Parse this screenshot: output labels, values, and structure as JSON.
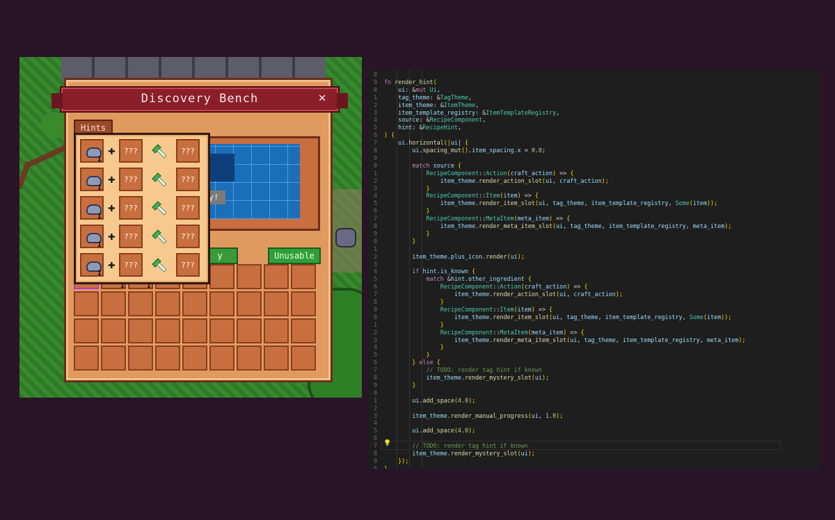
{
  "game": {
    "bench_title": "Discovery Bench",
    "close_glyph": "✕",
    "hints_tab_label": "Hints",
    "tooltip_fragment": "y!",
    "use_button_fragment": "y",
    "unusable_button_label": "Unusable",
    "hint_rows": [
      {
        "tier": "I",
        "slot2": "???",
        "slot3": "???"
      },
      {
        "tier": "I",
        "slot2": "???",
        "slot3": "???"
      },
      {
        "tier": "I",
        "slot2": "???",
        "slot3": "???"
      },
      {
        "tier": "I",
        "slot2": "???",
        "slot3": "???"
      },
      {
        "tier": "I",
        "slot2": "???",
        "slot3": "???"
      }
    ],
    "inventory_tiers": [
      "I",
      "I"
    ],
    "icons": {
      "ingredient": "stone-icon",
      "action": "green-hammer-icon",
      "plus": "plus-icon"
    }
  },
  "editor": {
    "lines": [
      {
        "n": "8",
        "t": ""
      },
      {
        "n": "9",
        "t": "fn render_hint("
      },
      {
        "n": "0",
        "t": "    ui: &mut Ui,"
      },
      {
        "n": "1",
        "t": "    tag_theme: &TagTheme,"
      },
      {
        "n": "2",
        "t": "    item_theme: &ItemTheme,"
      },
      {
        "n": "3",
        "t": "    item_template_registry: &ItemTemplateRegistry,"
      },
      {
        "n": "4",
        "t": "    source: &RecipeComponent,"
      },
      {
        "n": "5",
        "t": "    hint: &RecipeHint,"
      },
      {
        "n": "6",
        "t": ") {"
      },
      {
        "n": "7",
        "t": "    ui.horizontal(|ui| {"
      },
      {
        "n": "8",
        "t": "        ui.spacing_mut().item_spacing.x = 0.0;"
      },
      {
        "n": "9",
        "t": ""
      },
      {
        "n": "0",
        "t": "        match source {"
      },
      {
        "n": "1",
        "t": "            RecipeComponent::Action(craft_action) => {"
      },
      {
        "n": "2",
        "t": "                item_theme.render_action_slot(ui, craft_action);"
      },
      {
        "n": "3",
        "t": "            }"
      },
      {
        "n": "4",
        "t": "            RecipeComponent::Item(item) => {"
      },
      {
        "n": "5",
        "t": "                item_theme.render_item_slot(ui, tag_theme, item_template_registry, Some(item));"
      },
      {
        "n": "6",
        "t": "            }"
      },
      {
        "n": "7",
        "t": "            RecipeComponent::MetaItem(meta_item) => {"
      },
      {
        "n": "8",
        "t": "                item_theme.render_meta_item_slot(ui, tag_theme, item_template_registry, meta_item);"
      },
      {
        "n": "9",
        "t": "            }"
      },
      {
        "n": "0",
        "t": "        }"
      },
      {
        "n": "1",
        "t": ""
      },
      {
        "n": "2",
        "t": "        item_theme.plus_icon.render(ui);"
      },
      {
        "n": "3",
        "t": ""
      },
      {
        "n": "4",
        "t": "        if hint.is_known {"
      },
      {
        "n": "5",
        "t": "            match &hint.other_ingredient {"
      },
      {
        "n": "6",
        "t": "                RecipeComponent::Action(craft_action) => {"
      },
      {
        "n": "7",
        "t": "                    item_theme.render_action_slot(ui, craft_action);"
      },
      {
        "n": "8",
        "t": "                }"
      },
      {
        "n": "9",
        "t": "                RecipeComponent::Item(item) => {"
      },
      {
        "n": "0",
        "t": "                    item_theme.render_item_slot(ui, tag_theme, item_template_registry, Some(item));"
      },
      {
        "n": "1",
        "t": "                }"
      },
      {
        "n": "2",
        "t": "                RecipeComponent::MetaItem(meta_item) => {"
      },
      {
        "n": "3",
        "t": "                    item_theme.render_meta_item_slot(ui, tag_theme, item_template_registry, meta_item);"
      },
      {
        "n": "4",
        "t": "                }"
      },
      {
        "n": "5",
        "t": "            }"
      },
      {
        "n": "6",
        "t": "        } else {"
      },
      {
        "n": "7",
        "t": "            // TODO: render tag hint if known"
      },
      {
        "n": "8",
        "t": "            item_theme.render_mystery_slot(ui);"
      },
      {
        "n": "9",
        "t": "        }"
      },
      {
        "n": "0",
        "t": ""
      },
      {
        "n": "1",
        "t": "        ui.add_space(4.0);"
      },
      {
        "n": "2",
        "t": ""
      },
      {
        "n": "3",
        "t": "        item_theme.render_manual_progress(ui, 1.0);"
      },
      {
        "n": "4",
        "t": ""
      },
      {
        "n": "5",
        "t": "        ui.add_space(4.0);"
      },
      {
        "n": "6",
        "t": ""
      },
      {
        "n": "7",
        "t": "        // TODO: render tag hint if known"
      },
      {
        "n": "8",
        "t": "        item_theme.render_mystery_slot(ui);"
      },
      {
        "n": "9",
        "t": "    });"
      },
      {
        "n": "0",
        "t": "}"
      }
    ],
    "colors": {
      "keyword": "#c586c0",
      "fn": "#dcdcaa",
      "type": "#4ec9b0",
      "var": "#9cdcfe",
      "comment": "#6a9955",
      "number": "#b5cea8",
      "brace": "#ffd700"
    }
  }
}
